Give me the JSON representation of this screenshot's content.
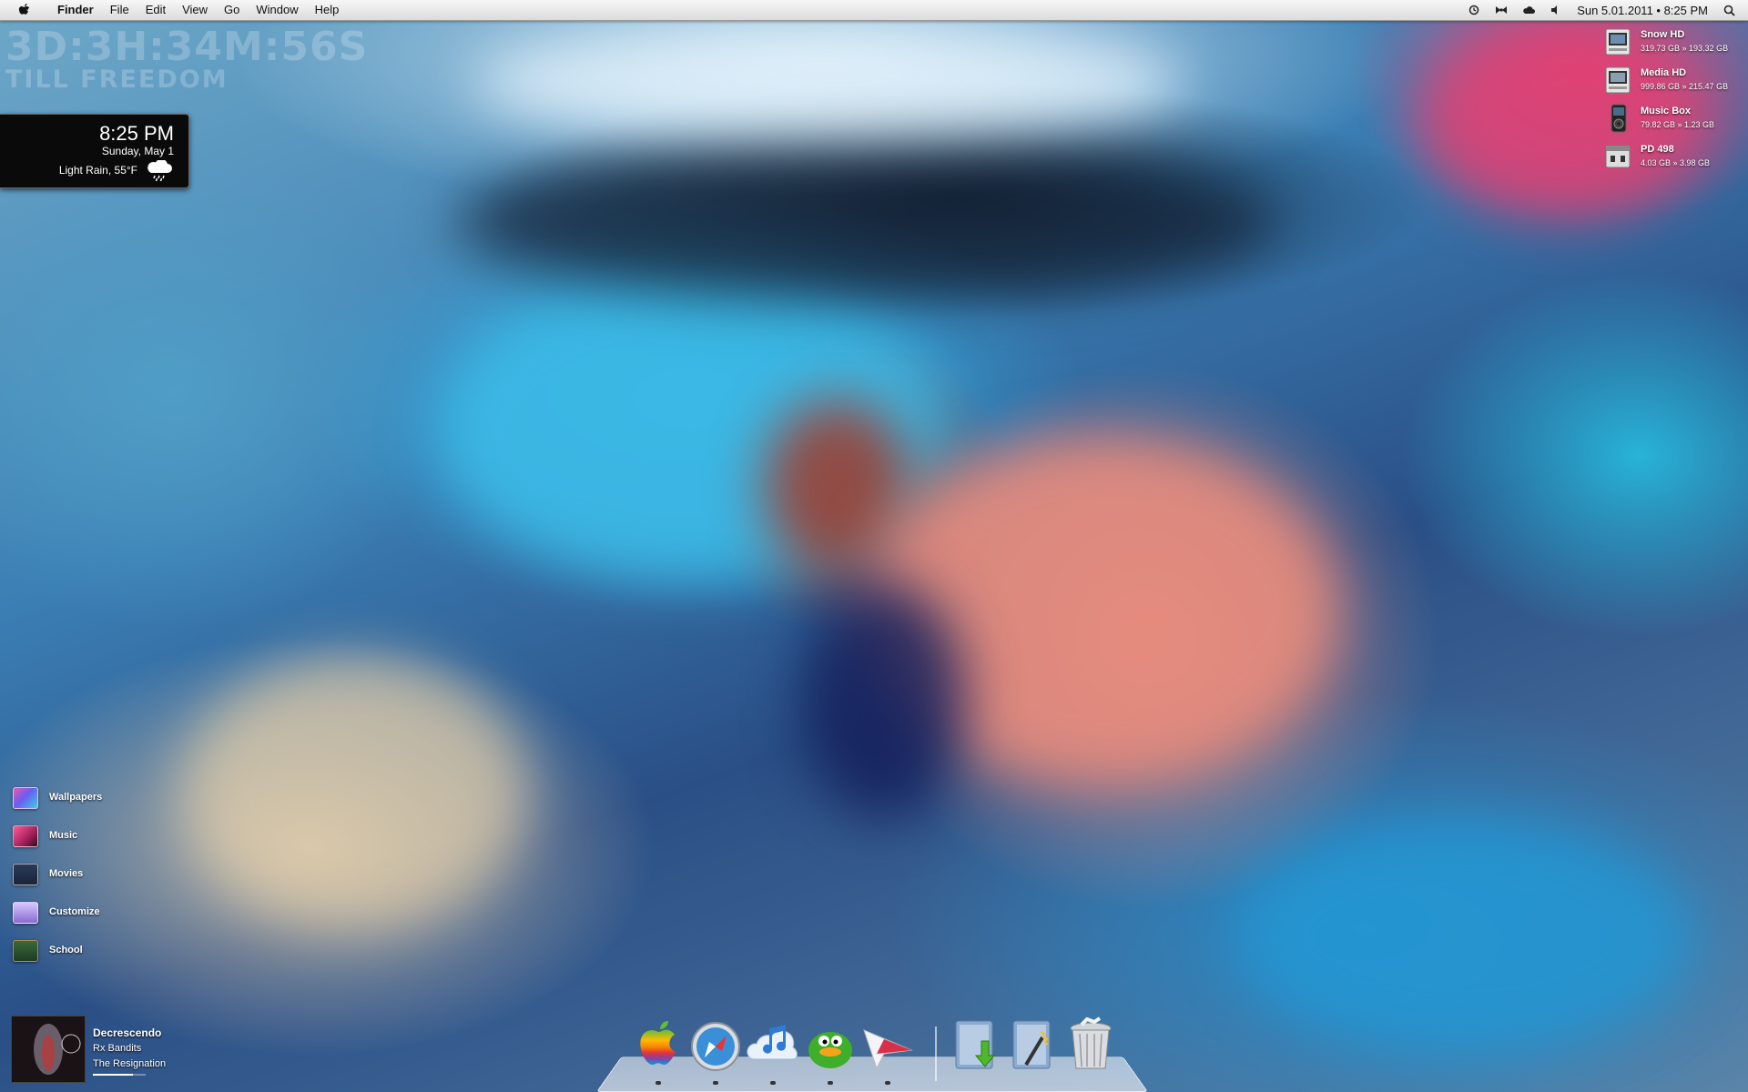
{
  "menubar": {
    "app_name": "Finder",
    "menus": [
      "File",
      "Edit",
      "View",
      "Go",
      "Window",
      "Help"
    ],
    "status_icons": [
      "time-machine-icon",
      "bowtie-icon",
      "cloud-icon",
      "volume-icon"
    ],
    "clock": "Sun  5.01.2011 • 8:25 PM"
  },
  "countdown": {
    "line1": "3D:3H:34M:56S",
    "line2": "TILL FREEDOM"
  },
  "clock_widget": {
    "time": "8:25 PM",
    "date": "Sunday, May  1",
    "weather": "Light Rain, 55°F"
  },
  "drives": [
    {
      "name": "Snow HD",
      "size": "319.73 GB  »  193.32 GB",
      "icon": "hard-drive-icon"
    },
    {
      "name": "Media HD",
      "size": "999.86 GB  »  215.47 GB",
      "icon": "hard-drive-icon"
    },
    {
      "name": "Music Box",
      "size": "79.82 GB  »  1.23 GB",
      "icon": "ipod-icon"
    },
    {
      "name": "PD 498",
      "size": "4.03 GB  »  3.98 GB",
      "icon": "usb-drive-icon"
    }
  ],
  "folders": [
    {
      "label": "Wallpapers"
    },
    {
      "label": "Music"
    },
    {
      "label": "Movies"
    },
    {
      "label": "Customize"
    },
    {
      "label": "School"
    }
  ],
  "now_playing": {
    "track": "Decrescendo",
    "artist": "Rx Bandits",
    "album": "The Resignation",
    "progress": 0.75
  },
  "dock": {
    "apps": [
      "apple-icon",
      "safari-icon",
      "itunes-icon",
      "adium-icon",
      "sparrow-icon"
    ],
    "stacks": [
      "downloads-stack-icon",
      "applications-stack-icon",
      "trash-icon"
    ]
  },
  "colors": {
    "menubar_bg": "#e8e8e8",
    "widget_bg": "#0a0a0a",
    "text_white": "#ffffff"
  }
}
